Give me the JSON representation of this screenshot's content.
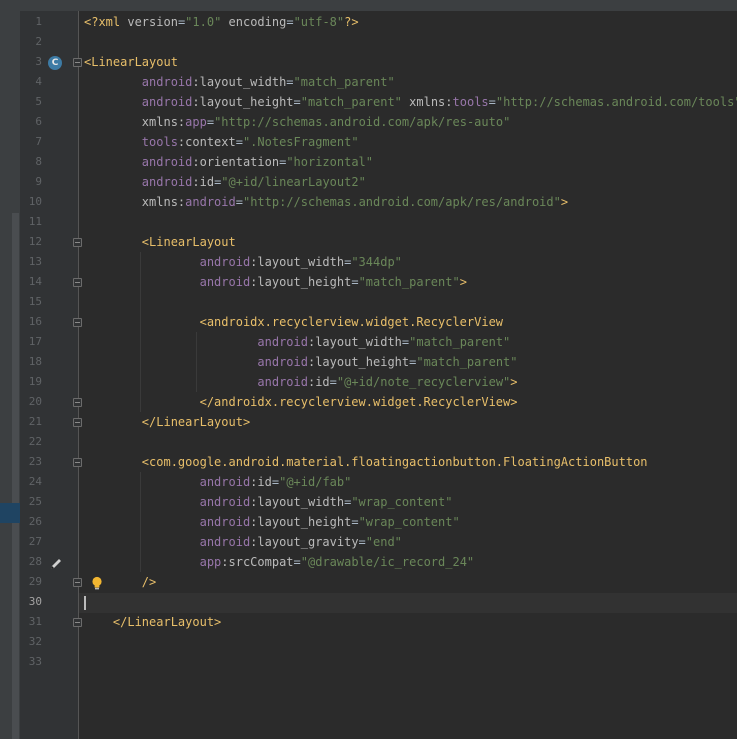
{
  "editor": {
    "current_line": "30",
    "lines": [
      {
        "n": "1",
        "code": [
          {
            "t": "tag",
            "v": "<?"
          },
          {
            "t": "tag",
            "v": "xml "
          },
          {
            "t": "attr",
            "v": "version"
          },
          {
            "t": "plain",
            "v": "="
          },
          {
            "t": "val",
            "v": "\"1.0\""
          },
          {
            "t": "plain",
            "v": " "
          },
          {
            "t": "attr",
            "v": "encoding"
          },
          {
            "t": "plain",
            "v": "="
          },
          {
            "t": "val",
            "v": "\"utf-8\""
          },
          {
            "t": "tag",
            "v": "?>"
          }
        ]
      },
      {
        "n": "2",
        "code": []
      },
      {
        "n": "3",
        "code": [
          {
            "t": "tag",
            "v": "<LinearLayout"
          }
        ]
      },
      {
        "n": "4",
        "code": [
          {
            "t": "plain",
            "v": "        "
          },
          {
            "t": "ns",
            "v": "android"
          },
          {
            "t": "attr",
            "v": ":layout_width"
          },
          {
            "t": "plain",
            "v": "="
          },
          {
            "t": "val",
            "v": "\"match_parent\""
          }
        ]
      },
      {
        "n": "5",
        "code": [
          {
            "t": "plain",
            "v": "        "
          },
          {
            "t": "ns",
            "v": "android"
          },
          {
            "t": "attr",
            "v": ":layout_height"
          },
          {
            "t": "plain",
            "v": "="
          },
          {
            "t": "val",
            "v": "\"match_parent\""
          },
          {
            "t": "plain",
            "v": " "
          },
          {
            "t": "attr",
            "v": "xmlns:"
          },
          {
            "t": "ns",
            "v": "tools"
          },
          {
            "t": "plain",
            "v": "="
          },
          {
            "t": "val",
            "v": "\"http://schemas.android.com/tools\""
          }
        ]
      },
      {
        "n": "6",
        "code": [
          {
            "t": "plain",
            "v": "        "
          },
          {
            "t": "attr",
            "v": "xmlns:"
          },
          {
            "t": "ns",
            "v": "app"
          },
          {
            "t": "plain",
            "v": "="
          },
          {
            "t": "val",
            "v": "\"http://schemas.android.com/apk/res-auto\""
          }
        ]
      },
      {
        "n": "7",
        "code": [
          {
            "t": "plain",
            "v": "        "
          },
          {
            "t": "ns",
            "v": "tools"
          },
          {
            "t": "attr",
            "v": ":context"
          },
          {
            "t": "plain",
            "v": "="
          },
          {
            "t": "val",
            "v": "\".NotesFragment\""
          }
        ]
      },
      {
        "n": "8",
        "code": [
          {
            "t": "plain",
            "v": "        "
          },
          {
            "t": "ns",
            "v": "android"
          },
          {
            "t": "attr",
            "v": ":orientation"
          },
          {
            "t": "plain",
            "v": "="
          },
          {
            "t": "val",
            "v": "\"horizontal\""
          }
        ]
      },
      {
        "n": "9",
        "code": [
          {
            "t": "plain",
            "v": "        "
          },
          {
            "t": "ns",
            "v": "android"
          },
          {
            "t": "attr",
            "v": ":id"
          },
          {
            "t": "plain",
            "v": "="
          },
          {
            "t": "val",
            "v": "\"@+id/linearLayout2\""
          }
        ]
      },
      {
        "n": "10",
        "code": [
          {
            "t": "plain",
            "v": "        "
          },
          {
            "t": "attr",
            "v": "xmlns:"
          },
          {
            "t": "ns",
            "v": "android"
          },
          {
            "t": "plain",
            "v": "="
          },
          {
            "t": "val",
            "v": "\"http://schemas.android.com/apk/res/android\""
          },
          {
            "t": "tag",
            "v": ">"
          }
        ]
      },
      {
        "n": "11",
        "code": []
      },
      {
        "n": "12",
        "code": [
          {
            "t": "plain",
            "v": "        "
          },
          {
            "t": "tag",
            "v": "<LinearLayout"
          }
        ]
      },
      {
        "n": "13",
        "code": [
          {
            "t": "plain",
            "v": "                "
          },
          {
            "t": "ns",
            "v": "android"
          },
          {
            "t": "attr",
            "v": ":layout_width"
          },
          {
            "t": "plain",
            "v": "="
          },
          {
            "t": "val",
            "v": "\"344dp\""
          }
        ]
      },
      {
        "n": "14",
        "code": [
          {
            "t": "plain",
            "v": "                "
          },
          {
            "t": "ns",
            "v": "android"
          },
          {
            "t": "attr",
            "v": ":layout_height"
          },
          {
            "t": "plain",
            "v": "="
          },
          {
            "t": "val",
            "v": "\"match_parent\""
          },
          {
            "t": "tag",
            "v": ">"
          }
        ]
      },
      {
        "n": "15",
        "code": []
      },
      {
        "n": "16",
        "code": [
          {
            "t": "plain",
            "v": "                "
          },
          {
            "t": "tag",
            "v": "<androidx.recyclerview.widget.RecyclerView"
          }
        ]
      },
      {
        "n": "17",
        "code": [
          {
            "t": "plain",
            "v": "                        "
          },
          {
            "t": "ns",
            "v": "android"
          },
          {
            "t": "attr",
            "v": ":layout_width"
          },
          {
            "t": "plain",
            "v": "="
          },
          {
            "t": "val",
            "v": "\"match_parent\""
          }
        ]
      },
      {
        "n": "18",
        "code": [
          {
            "t": "plain",
            "v": "                        "
          },
          {
            "t": "ns",
            "v": "android"
          },
          {
            "t": "attr",
            "v": ":layout_height"
          },
          {
            "t": "plain",
            "v": "="
          },
          {
            "t": "val",
            "v": "\"match_parent\""
          }
        ]
      },
      {
        "n": "19",
        "code": [
          {
            "t": "plain",
            "v": "                        "
          },
          {
            "t": "ns",
            "v": "android"
          },
          {
            "t": "attr",
            "v": ":id"
          },
          {
            "t": "plain",
            "v": "="
          },
          {
            "t": "val",
            "v": "\"@+id/note_recyclerview\""
          },
          {
            "t": "tag",
            "v": ">"
          }
        ]
      },
      {
        "n": "20",
        "code": [
          {
            "t": "plain",
            "v": "                "
          },
          {
            "t": "tag",
            "v": "</androidx.recyclerview.widget.RecyclerView>"
          }
        ]
      },
      {
        "n": "21",
        "code": [
          {
            "t": "plain",
            "v": "        "
          },
          {
            "t": "tag",
            "v": "</LinearLayout>"
          }
        ]
      },
      {
        "n": "22",
        "code": []
      },
      {
        "n": "23",
        "code": [
          {
            "t": "plain",
            "v": "        "
          },
          {
            "t": "tag",
            "v": "<com.google.android.material.floatingactionbutton.FloatingActionButton"
          }
        ]
      },
      {
        "n": "24",
        "code": [
          {
            "t": "plain",
            "v": "                "
          },
          {
            "t": "ns",
            "v": "android"
          },
          {
            "t": "attr",
            "v": ":id"
          },
          {
            "t": "plain",
            "v": "="
          },
          {
            "t": "val",
            "v": "\"@+id/fab\""
          }
        ]
      },
      {
        "n": "25",
        "code": [
          {
            "t": "plain",
            "v": "                "
          },
          {
            "t": "ns",
            "v": "android"
          },
          {
            "t": "attr",
            "v": ":layout_width"
          },
          {
            "t": "plain",
            "v": "="
          },
          {
            "t": "val",
            "v": "\"wrap_content\""
          }
        ]
      },
      {
        "n": "26",
        "code": [
          {
            "t": "plain",
            "v": "                "
          },
          {
            "t": "ns",
            "v": "android"
          },
          {
            "t": "attr",
            "v": ":layout_height"
          },
          {
            "t": "plain",
            "v": "="
          },
          {
            "t": "val",
            "v": "\"wrap_content\""
          }
        ]
      },
      {
        "n": "27",
        "code": [
          {
            "t": "plain",
            "v": "                "
          },
          {
            "t": "ns",
            "v": "android"
          },
          {
            "t": "attr",
            "v": ":layout_gravity"
          },
          {
            "t": "plain",
            "v": "="
          },
          {
            "t": "val",
            "v": "\"end\""
          }
        ]
      },
      {
        "n": "28",
        "code": [
          {
            "t": "plain",
            "v": "                "
          },
          {
            "t": "ns",
            "v": "app"
          },
          {
            "t": "attr",
            "v": ":srcCompat"
          },
          {
            "t": "plain",
            "v": "="
          },
          {
            "t": "val",
            "v": "\"@drawable/ic_record_24\""
          }
        ]
      },
      {
        "n": "29",
        "code": [
          {
            "t": "plain",
            "v": "        "
          },
          {
            "t": "tag",
            "v": "/>"
          }
        ]
      },
      {
        "n": "30",
        "code": []
      },
      {
        "n": "31",
        "code": [
          {
            "t": "plain",
            "v": "    "
          },
          {
            "t": "tag",
            "v": "</LinearLayout>"
          }
        ]
      },
      {
        "n": "32",
        "code": []
      },
      {
        "n": "33",
        "code": []
      }
    ]
  },
  "gutter": {
    "class_badge_letter": "C",
    "class_badge_color": "#3d7ba5",
    "icons": [
      "class-icon",
      "pencil-icon",
      "lightbulb-icon",
      "fold-icon"
    ]
  },
  "colors": {
    "background": "#2b2b2b",
    "tag": "#e8bf6a",
    "namespace": "#9876aa",
    "attribute": "#bababa",
    "value": "#6a8759",
    "line_number": "#606366"
  }
}
